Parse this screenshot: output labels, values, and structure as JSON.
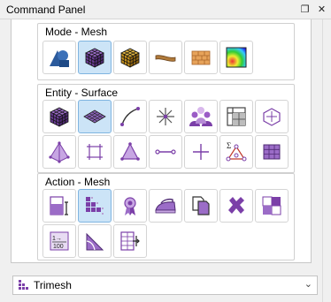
{
  "panel": {
    "title": "Command Panel",
    "restore_glyph": "❐",
    "close_glyph": "✕"
  },
  "groups": {
    "mode": {
      "label": "Mode - Mesh"
    },
    "entity": {
      "label": "Entity - Surface"
    },
    "action": {
      "label": "Action - Mesh"
    }
  },
  "dropdown": {
    "selected": "Trimesh",
    "arrow": "⌄"
  },
  "colors": {
    "accent_purple": "#7b3fa8",
    "active_bg": "#cce4f7"
  }
}
